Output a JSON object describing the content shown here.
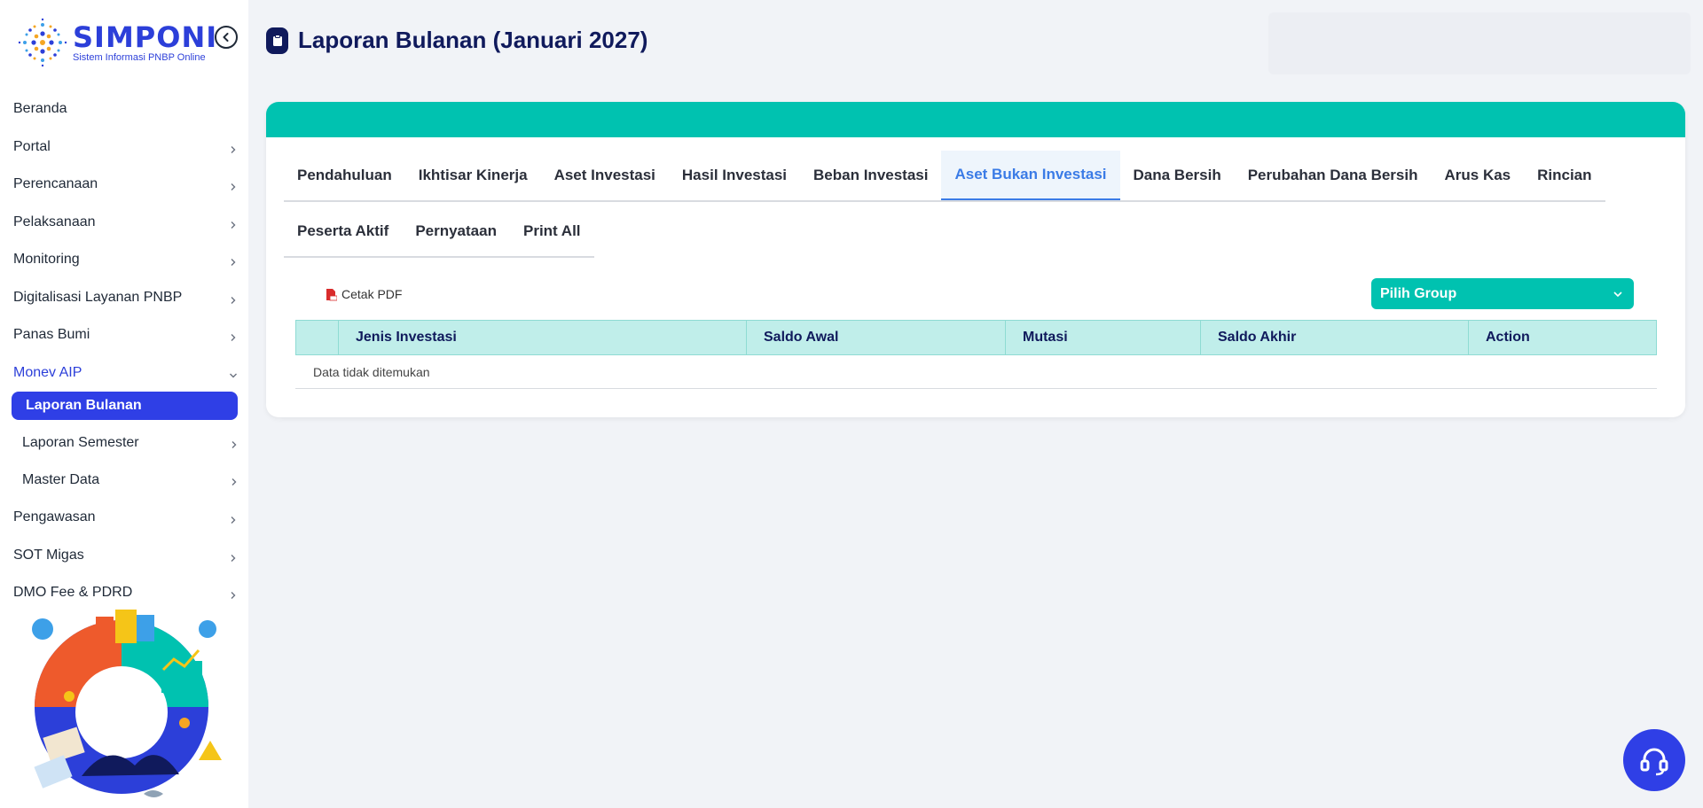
{
  "app": {
    "name": "SIMPONI",
    "subtitle": "Sistem Informasi PNBP Online"
  },
  "sidebar": {
    "items": [
      {
        "label": "Beranda",
        "chevron": false
      },
      {
        "label": "Portal",
        "chevron": true
      },
      {
        "label": "Perencanaan",
        "chevron": true
      },
      {
        "label": "Pelaksanaan",
        "chevron": true
      },
      {
        "label": "Monitoring",
        "chevron": true
      },
      {
        "label": "Digitalisasi Layanan PNBP",
        "chevron": true
      },
      {
        "label": "Panas Bumi",
        "chevron": true
      },
      {
        "label": "Monev AIP",
        "chevron": true,
        "expanded": true
      }
    ],
    "submenu": [
      {
        "label": "Laporan Bulanan",
        "active": true
      },
      {
        "label": "Laporan Semester",
        "chevron": true
      },
      {
        "label": "Master Data",
        "chevron": true
      }
    ],
    "items_after": [
      {
        "label": "Pengawasan",
        "chevron": true
      },
      {
        "label": "SOT Migas",
        "chevron": true
      },
      {
        "label": "DMO Fee & PDRD",
        "chevron": true
      }
    ]
  },
  "header": {
    "title": "Laporan Bulanan (Januari 2027)"
  },
  "tabs": {
    "row1": [
      "Pendahuluan",
      "Ikhtisar Kinerja",
      "Aset Investasi",
      "Hasil Investasi",
      "Beban Investasi",
      "Aset Bukan Investasi",
      "Dana Bersih",
      "Perubahan Dana Bersih",
      "Arus Kas",
      "Rincian"
    ],
    "row2": [
      "Peserta Aktif",
      "Pernyataan",
      "Print All"
    ],
    "active": "Aset Bukan Investasi"
  },
  "toolbar": {
    "pdf_label": "Cetak PDF",
    "group_select": "Pilih Group"
  },
  "table": {
    "columns": [
      "",
      "Jenis Investasi",
      "Saldo Awal",
      "Mutasi",
      "Saldo Akhir",
      "Action"
    ],
    "empty_message": "Data tidak ditemukan"
  },
  "colors": {
    "primary": "#2f3fe6",
    "teal": "#00c2b0",
    "navy": "#101a5c",
    "active_tab": "#3a7be6"
  }
}
